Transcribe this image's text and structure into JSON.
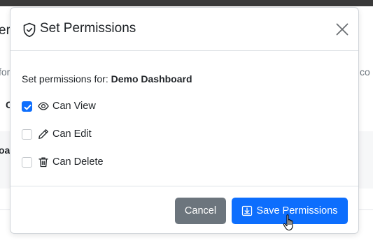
{
  "background": {
    "fragments": [
      "er",
      "for",
      "C",
      "oar",
      "co"
    ]
  },
  "modal": {
    "title": "Set Permissions",
    "title_icon": "shield-check-icon",
    "close_icon": "close-icon",
    "body": {
      "for_label": "Set permissions for:",
      "target_name": "Demo Dashboard",
      "permissions": [
        {
          "label": "Can View",
          "icon": "eye-icon",
          "checked": true
        },
        {
          "label": "Can Edit",
          "icon": "pencil-icon",
          "checked": false
        },
        {
          "label": "Can Delete",
          "icon": "trash-icon",
          "checked": false
        }
      ]
    },
    "footer": {
      "cancel_label": "Cancel",
      "save_label": "Save Permissions",
      "save_icon": "download-box-icon"
    }
  },
  "colors": {
    "primary": "#0d6efd",
    "secondary": "#6c757d",
    "text": "#212529"
  }
}
